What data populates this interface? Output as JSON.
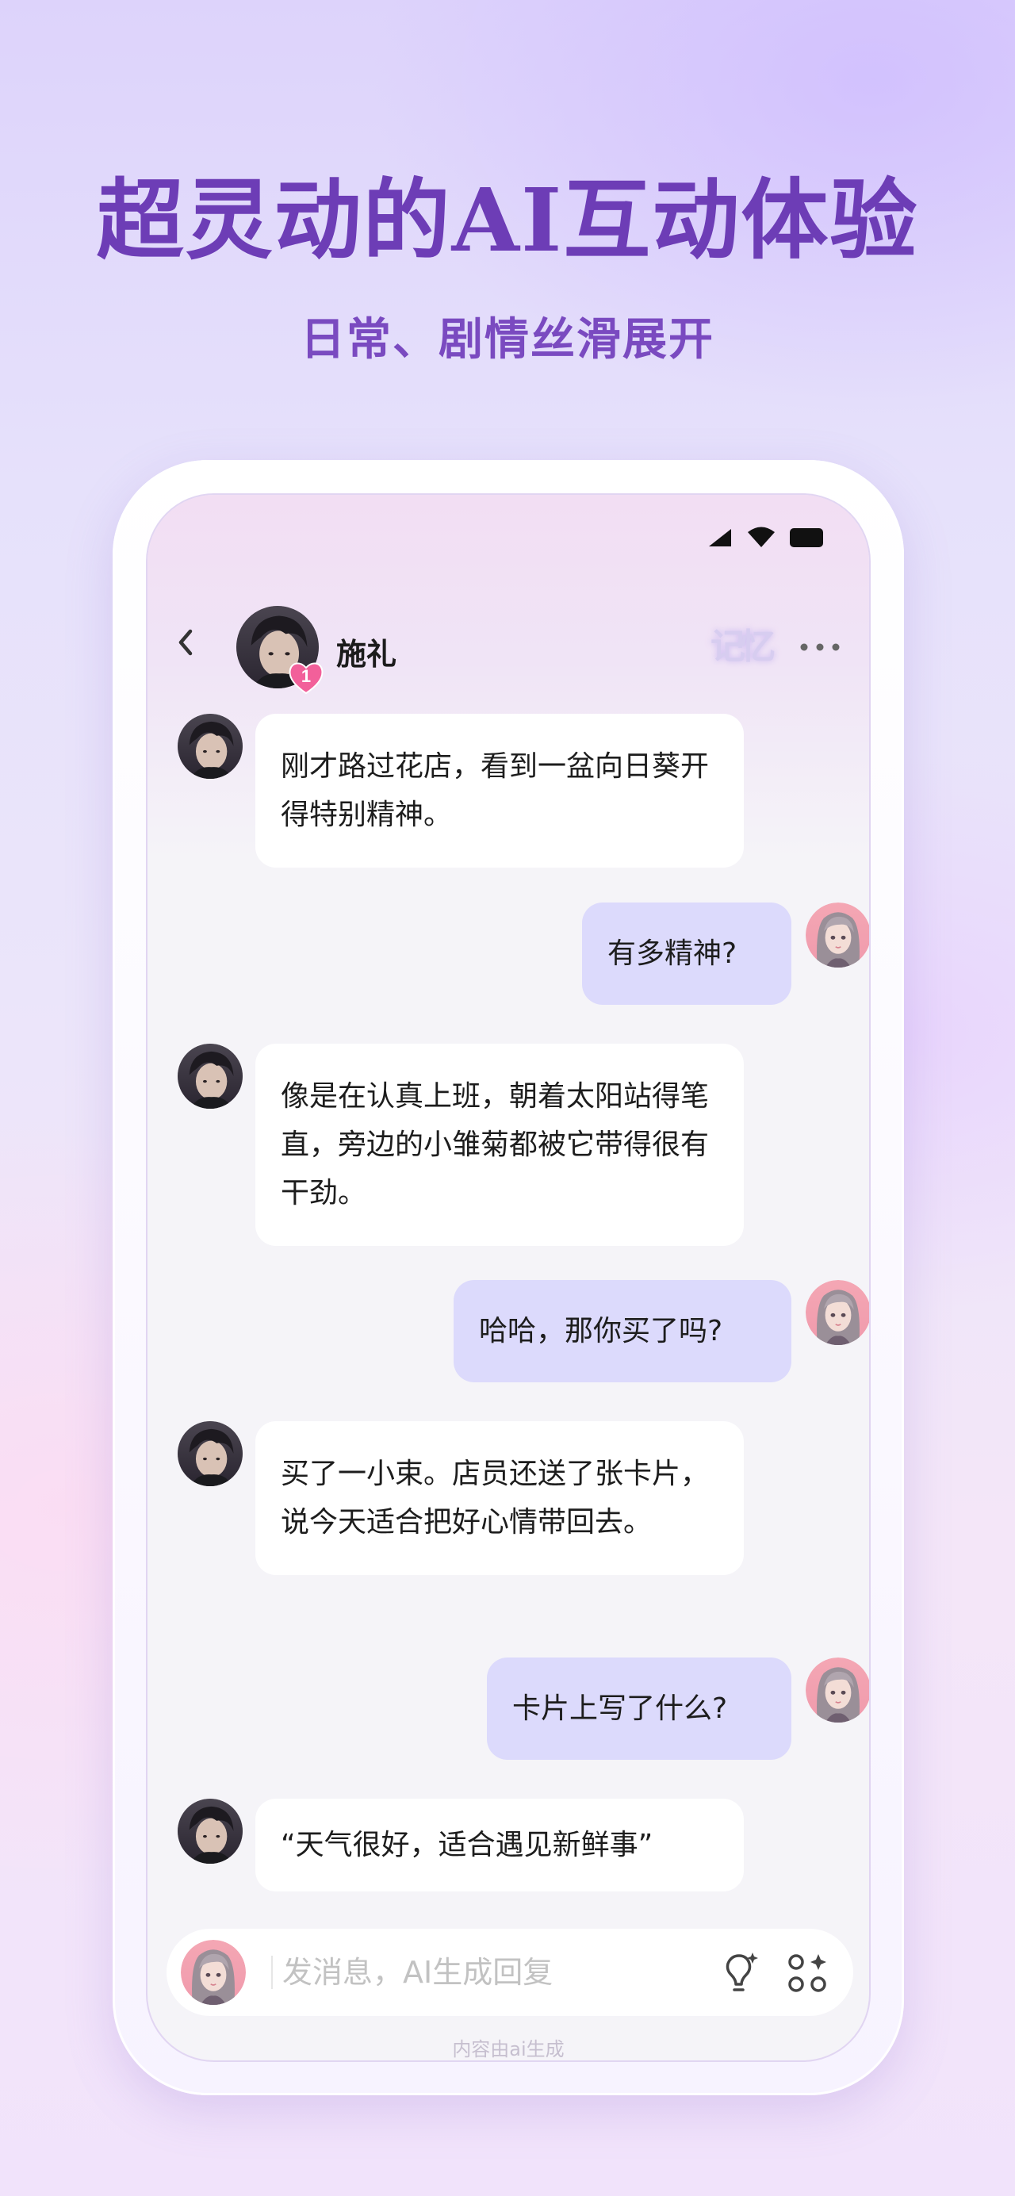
{
  "hero": {
    "title": "超灵动的AI互动体验",
    "subtitle": "日常、剧情丝滑展开"
  },
  "status_bar": {
    "icons": [
      "signal-icon",
      "wifi-icon",
      "battery-icon"
    ]
  },
  "header": {
    "contact_name": "施礼",
    "intimacy_level": "1",
    "memory_label": "记忆",
    "back_icon": "chevron-left-icon",
    "more_icon": "more-dots-icon"
  },
  "messages": [
    {
      "sender": "ai",
      "text": "刚才路过花店，看到一盆向日葵开得特别精神。"
    },
    {
      "sender": "user",
      "text": "有多精神?"
    },
    {
      "sender": "ai",
      "text": "像是在认真上班，朝着太阳站得笔直，旁边的小雏菊都被它带得很有干劲。"
    },
    {
      "sender": "user",
      "text": "哈哈，那你买了吗?"
    },
    {
      "sender": "ai",
      "text": "买了一小束。店员还送了张卡片，说今天适合把好心情带回去。"
    },
    {
      "sender": "user",
      "text": "卡片上写了什么?"
    },
    {
      "sender": "ai",
      "text": "“天气很好，适合遇见新鲜事”"
    }
  ],
  "input": {
    "placeholder": "发消息，AI生成回复",
    "value": ""
  },
  "footer": {
    "disclaimer": "内容由ai生成"
  },
  "colors": {
    "accent": "#6d3db6",
    "user_bubble": "#dcdafc",
    "ai_bubble": "#ffffff",
    "heart": "#f2609a"
  }
}
